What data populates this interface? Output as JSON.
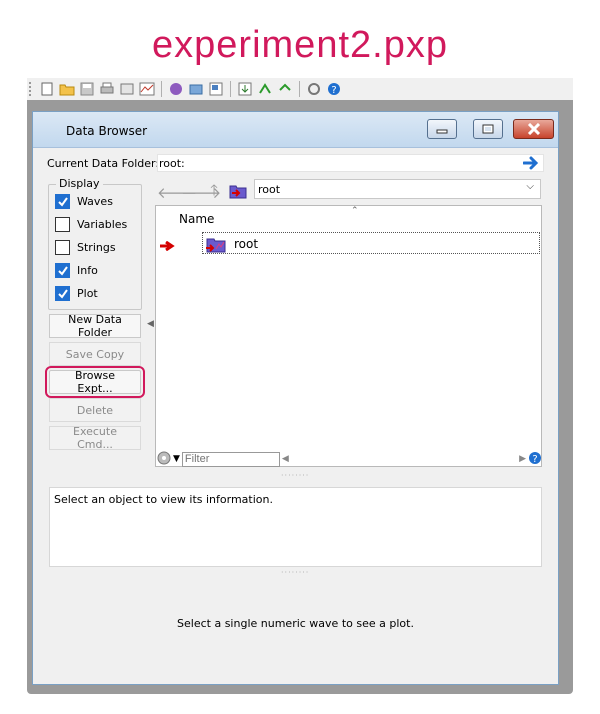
{
  "heading": "experiment2.pxp",
  "toolbar": {
    "icons": [
      "new-icon",
      "open-icon",
      "save-icon",
      "print-icon",
      "page-setup-icon",
      "graph-icon",
      "procedure-icon",
      "data-browser-icon",
      "layout-icon",
      "load-icon",
      "save-waves-icon",
      "export-icon",
      "misc-icon",
      "help-icon"
    ]
  },
  "window": {
    "title": "Data Browser",
    "current_folder_label": "Current Data Folder:",
    "current_folder_value": "root:",
    "display_legend": "Display",
    "checkboxes": [
      {
        "label": "Waves",
        "checked": true
      },
      {
        "label": "Variables",
        "checked": false
      },
      {
        "label": "Strings",
        "checked": false
      },
      {
        "label": "Info",
        "checked": true
      },
      {
        "label": "Plot",
        "checked": true
      }
    ],
    "buttons": [
      {
        "label": "New Data Folder",
        "enabled": true
      },
      {
        "label": "Save Copy",
        "enabled": false
      },
      {
        "label": "Browse Expt...",
        "enabled": true
      },
      {
        "label": "Delete",
        "enabled": false
      },
      {
        "label": "Execute Cmd...",
        "enabled": false
      }
    ],
    "folder_select_value": "root",
    "list": {
      "column_header": "Name",
      "rows": [
        {
          "label": "root"
        }
      ]
    },
    "filter_placeholder": "Filter",
    "info_text": "Select an object to view its information.",
    "plot_text": "Select a single numeric wave to see a plot."
  },
  "colors": {
    "accent": "#d1195c",
    "checkbox": "#1f6fd0",
    "nav_arrow": "#1f6fd0",
    "current_arrow": "#d40000"
  }
}
